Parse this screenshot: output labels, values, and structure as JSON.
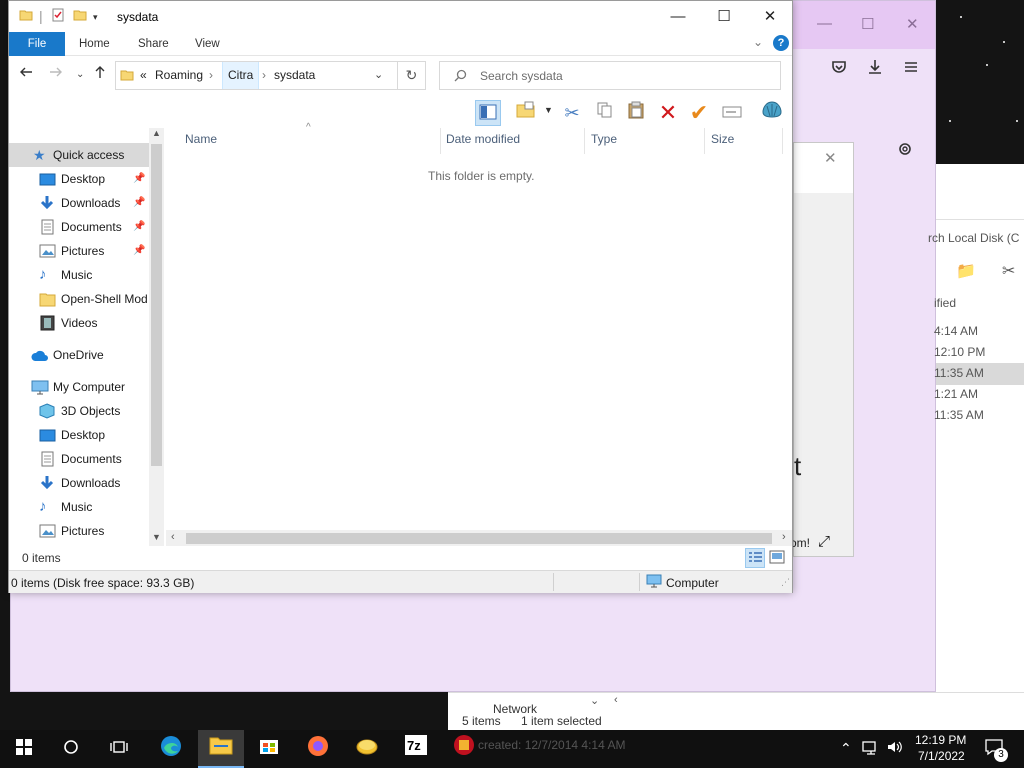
{
  "explorer": {
    "title": "sysdata",
    "ribbon_tabs": [
      "File",
      "Home",
      "Share",
      "View"
    ],
    "breadcrumb_overflow": "«",
    "breadcrumb": [
      "Roaming",
      "Citra",
      "sysdata"
    ],
    "search_placeholder": "Search sysdata",
    "columns": [
      "Name",
      "Date modified",
      "Type",
      "Size"
    ],
    "empty_message": "This folder is empty.",
    "item_count": "0 items",
    "status_left": "0 items (Disk free space: 93.3 GB)",
    "status_right": "Computer",
    "nav": {
      "quick_access": "Quick access",
      "quick_items": [
        "Desktop",
        "Downloads",
        "Documents",
        "Pictures",
        "Music",
        "Open-Shell Mod",
        "Videos"
      ],
      "onedrive": "OneDrive",
      "my_computer": "My Computer",
      "computer_items": [
        "3D Objects",
        "Desktop",
        "Documents",
        "Downloads",
        "Music",
        "Pictures"
      ]
    },
    "toolbar_icons": [
      "pane-icon",
      "properties-icon",
      "cut-icon",
      "copy-icon",
      "paste-icon",
      "delete-icon",
      "check-icon",
      "rename-icon",
      "shell-icon"
    ]
  },
  "bg_right_window": {
    "search_fragment": "rch Local Disk (C",
    "header_fragment": "ified",
    "times": [
      "4:14 AM",
      "12:10 PM",
      "11:35 AM",
      "1:21 AM",
      "11:35 AM"
    ]
  },
  "bg_dialog": {
    "text_fragment": "om!",
    "large_letter": "t"
  },
  "bg_bottom_window": {
    "items": "5 items",
    "selected": "1 item selected",
    "created": "created: 12/7/2014 4:14 AM",
    "tree_fragment": "Network"
  },
  "taskbar": {
    "time": "12:19 PM",
    "date": "7/1/2022",
    "notifications": "3"
  }
}
